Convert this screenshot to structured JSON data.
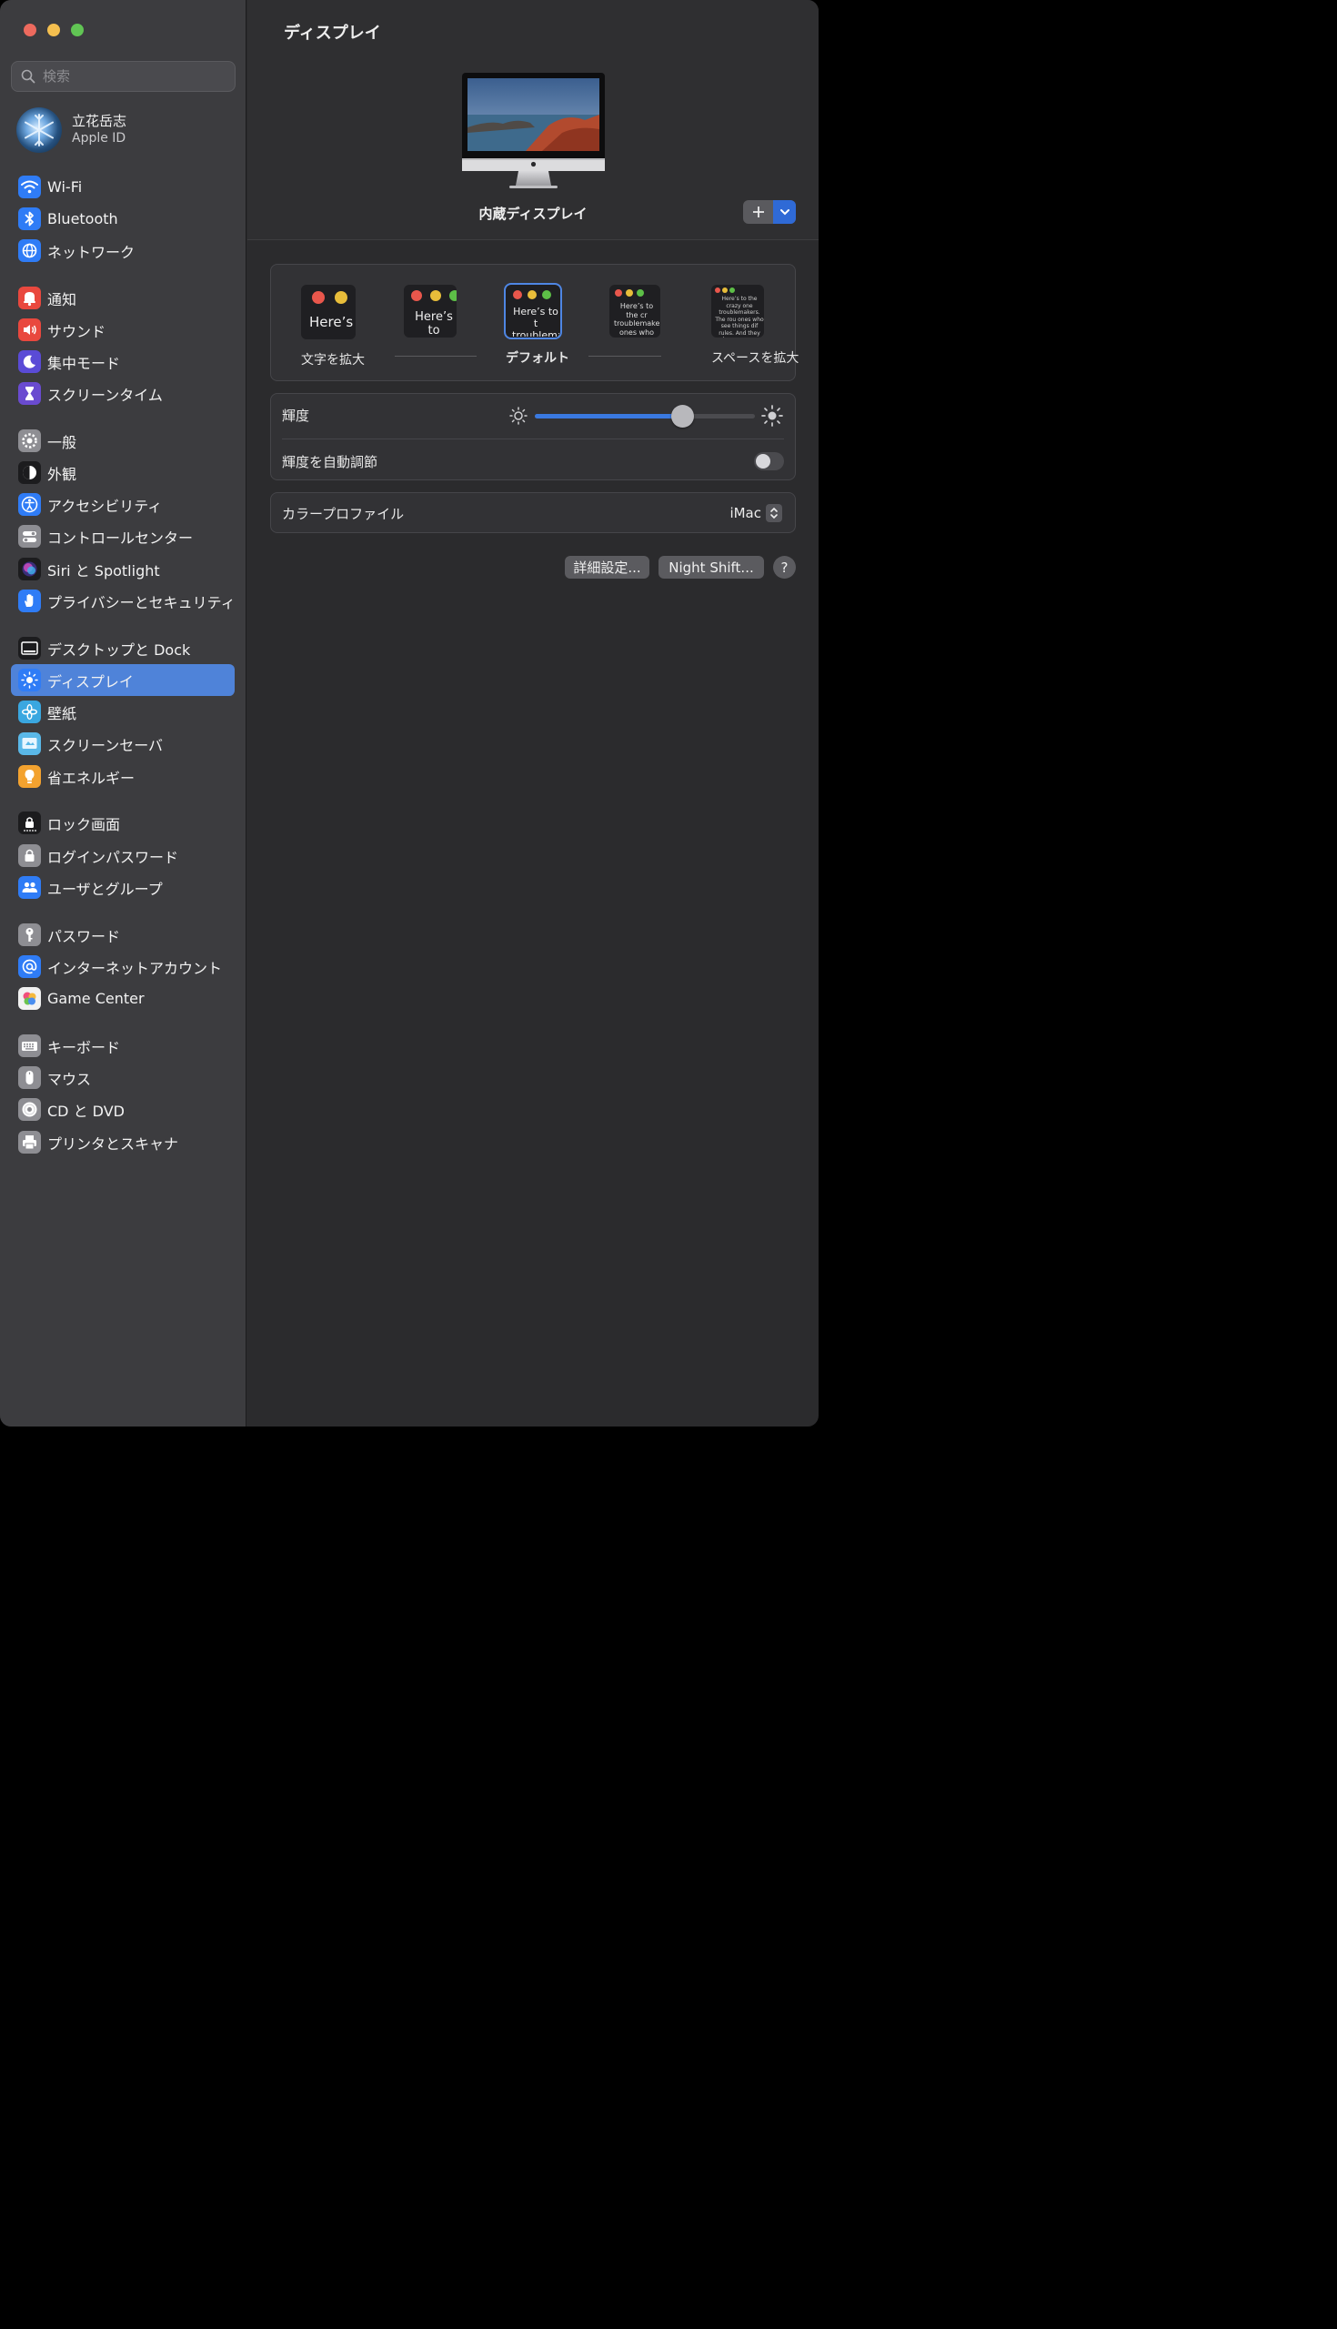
{
  "window": {
    "traffic_lights": {
      "close": "#ed6a5e",
      "minimize": "#f4bf4f",
      "zoom": "#61c554"
    }
  },
  "sidebar": {
    "search_placeholder": "検索",
    "account": {
      "name": "立花岳志",
      "subtitle": "Apple ID"
    },
    "items": [
      {
        "label": "Wi-Fi",
        "icon": "wifi-icon",
        "color": "#2f7cf6"
      },
      {
        "label": "Bluetooth",
        "icon": "bluetooth-icon",
        "color": "#2f7cf6"
      },
      {
        "label": "ネットワーク",
        "icon": "globe-icon",
        "color": "#2f7cf6"
      },
      {
        "label": "通知",
        "icon": "bell-icon",
        "color": "#e9483e"
      },
      {
        "label": "サウンド",
        "icon": "speaker-icon",
        "color": "#e9483e"
      },
      {
        "label": "集中モード",
        "icon": "moon-icon",
        "color": "#5a4bd6"
      },
      {
        "label": "スクリーンタイム",
        "icon": "hourglass-icon",
        "color": "#6a4bd0"
      },
      {
        "label": "一般",
        "icon": "gear-icon",
        "color": "#8e8e93"
      },
      {
        "label": "外観",
        "icon": "appearance-icon",
        "color": "#1c1c1e"
      },
      {
        "label": "アクセシビリティ",
        "icon": "accessibility-icon",
        "color": "#2f7cf6"
      },
      {
        "label": "コントロールセンター",
        "icon": "switches-icon",
        "color": "#8e8e93"
      },
      {
        "label": "Siri と Spotlight",
        "icon": "siri-icon",
        "color": "#1c1c1e"
      },
      {
        "label": "プライバシーとセキュリティ",
        "icon": "hand-icon",
        "color": "#2f7cf6"
      },
      {
        "label": "デスクトップと Dock",
        "icon": "dock-icon",
        "color": "#1c1c1e"
      },
      {
        "label": "ディスプレイ",
        "icon": "sun-icon",
        "color": "#2f7cf6"
      },
      {
        "label": "壁紙",
        "icon": "flower-icon",
        "color": "#3aa7e0"
      },
      {
        "label": "スクリーンセーバ",
        "icon": "screensaver-icon",
        "color": "#5ab8e8"
      },
      {
        "label": "省エネルギー",
        "icon": "bulb-icon",
        "color": "#f3a22f"
      },
      {
        "label": "ロック画面",
        "icon": "lock-screen-icon",
        "color": "#1c1c1e"
      },
      {
        "label": "ログインパスワード",
        "icon": "lock-icon",
        "color": "#8e8e93"
      },
      {
        "label": "ユーザとグループ",
        "icon": "users-icon",
        "color": "#2f7cf6"
      },
      {
        "label": "パスワード",
        "icon": "key-icon",
        "color": "#8e8e93"
      },
      {
        "label": "インターネットアカウント",
        "icon": "at-icon",
        "color": "#2f7cf6"
      },
      {
        "label": "Game Center",
        "icon": "game-center-icon",
        "color": "#f2f2f2"
      },
      {
        "label": "キーボード",
        "icon": "keyboard-icon",
        "color": "#8e8e93"
      },
      {
        "label": "マウス",
        "icon": "mouse-icon",
        "color": "#8e8e93"
      },
      {
        "label": "CD と DVD",
        "icon": "disc-icon",
        "color": "#8e8e93"
      },
      {
        "label": "プリンタとスキャナ",
        "icon": "printer-icon",
        "color": "#8e8e93"
      }
    ],
    "selected": "ディスプレイ"
  },
  "main": {
    "title": "ディスプレイ",
    "display_name": "内蔵ディスプレイ",
    "resolution": {
      "options": [
        {
          "caption": "文字を拡大",
          "sample": "Here’s"
        },
        {
          "caption": "",
          "sample": "Here’s to troublem"
        },
        {
          "caption": "デフォルト",
          "sample": "Here’s to t troublema ones who"
        },
        {
          "caption": "",
          "sample": "Here’s to the cr troublemakers. ones who see t rules. And they"
        },
        {
          "caption": "スペースを拡大",
          "sample": "Here’s to the crazy one troublemakers. The rou ones who see things dif rules. And they have no can quote them, disagre them. About the only th Because they change t"
        }
      ],
      "selected": "デフォルト"
    },
    "brightness": {
      "label": "輝度",
      "level": 0.67
    },
    "auto_brightness": {
      "label": "輝度を自動調節",
      "on": false
    },
    "color_profile": {
      "label": "カラープロファイル",
      "value": "iMac"
    },
    "buttons": {
      "advanced": "詳細設定...",
      "night_shift": "Night Shift...",
      "help": "?"
    },
    "accent": "#3a79e0"
  }
}
